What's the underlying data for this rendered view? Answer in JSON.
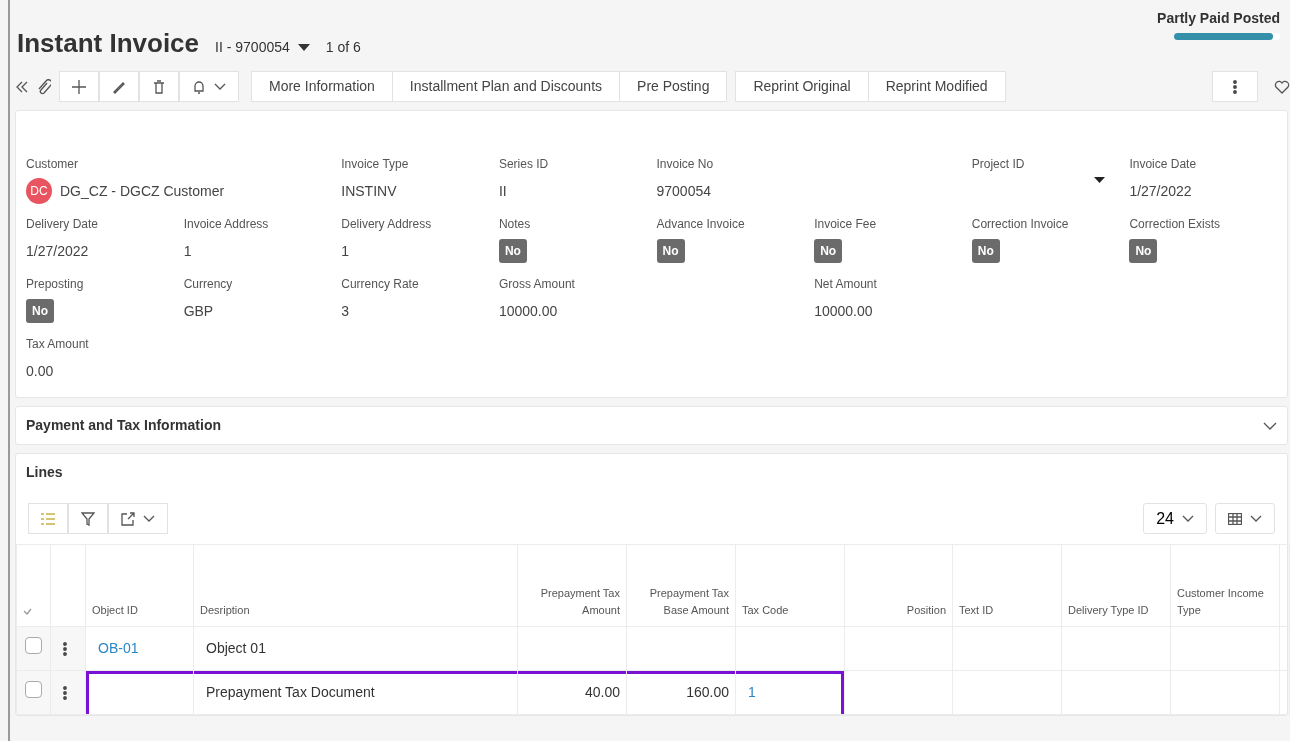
{
  "header": {
    "title": "Instant Invoice",
    "record": "II - 9700054",
    "pager": "1 of 6",
    "status": {
      "label": "Partly Paid Posted",
      "level": 0.93
    }
  },
  "toolbar": {
    "actions": [
      "More Information",
      "Installment Plan and Discounts",
      "Pre Posting"
    ],
    "print_actions": [
      "Reprint Original",
      "Reprint Modified"
    ]
  },
  "fields": [
    {
      "label": "Customer",
      "kind": "avatar",
      "initials": "DC",
      "value": "DG_CZ - DGCZ Customer"
    },
    {
      "label": "Invoice Type",
      "kind": "text",
      "value": "INSTINV"
    },
    {
      "label": "Series ID",
      "kind": "text",
      "value": "II"
    },
    {
      "label": "Invoice No",
      "kind": "text",
      "value": "9700054"
    },
    {
      "label": "Project ID",
      "kind": "dropdown"
    },
    {
      "label": "Invoice Date",
      "kind": "text",
      "value": "1/27/2022"
    },
    {
      "label": "Delivery Date",
      "kind": "text",
      "value": "1/27/2022"
    },
    {
      "label": "Invoice Address",
      "kind": "text",
      "value": "1"
    },
    {
      "label": "Delivery Address",
      "kind": "text",
      "value": "1"
    },
    {
      "label": "Notes",
      "kind": "toggle",
      "value": "No",
      "on": false
    },
    {
      "label": "Advance Invoice",
      "kind": "toggle",
      "value": "No",
      "on": false
    },
    {
      "label": "Invoice Fee",
      "kind": "toggle",
      "value": "No",
      "on": false
    },
    {
      "label": "Correction Invoice",
      "kind": "toggle",
      "value": "No",
      "on": false
    },
    {
      "label": "Correction Exists",
      "kind": "toggle",
      "value": "No",
      "on": false
    },
    {
      "label": "Preposting",
      "kind": "toggle",
      "value": "No",
      "on": false
    },
    {
      "label": "Currency",
      "kind": "text",
      "value": "GBP"
    },
    {
      "label": "Currency Rate",
      "kind": "text",
      "value": "3"
    },
    {
      "label": "Gross Amount",
      "kind": "text",
      "value": "10000.00"
    },
    {
      "label": "Net Amount",
      "kind": "text",
      "value": "10000.00"
    },
    {
      "label": "Tax Amount",
      "kind": "text",
      "value": "0.00"
    }
  ],
  "payment_panel": {
    "title": "Payment and Tax Information",
    "expanded": false
  },
  "lines": {
    "title": "Lines",
    "page_size": "24",
    "columns": [
      "Object ID",
      "Desription",
      "Prepayment Tax Amount",
      "Prepayment Tax Base Amount",
      "Tax Code",
      "Position",
      "Text ID",
      "Delivery Type ID",
      "Customer Income Type"
    ],
    "rows": [
      {
        "selected": false,
        "highlighted": false,
        "cells": [
          "OB-01",
          "Object 01",
          "",
          "",
          "",
          "",
          "",
          "",
          ""
        ]
      },
      {
        "selected": false,
        "highlighted": true,
        "cells": [
          "",
          "Prepayment Tax Document",
          "40.00",
          "160.00",
          "1",
          "",
          "",
          "",
          ""
        ]
      }
    ]
  }
}
